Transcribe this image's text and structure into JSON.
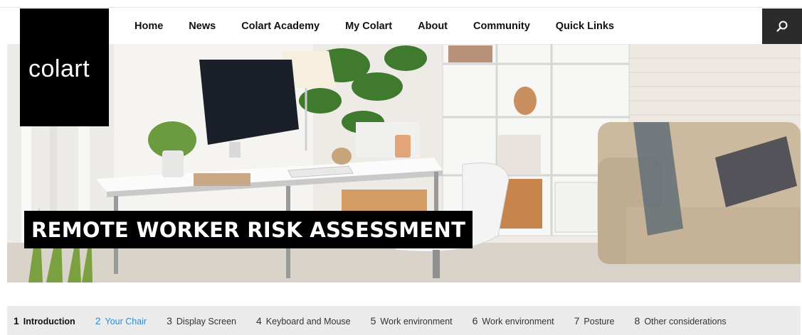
{
  "brand": {
    "logo_text": "colart"
  },
  "nav": {
    "items": [
      {
        "label": "Home"
      },
      {
        "label": "News"
      },
      {
        "label": "Colart Academy"
      },
      {
        "label": "My Colart"
      },
      {
        "label": "About"
      },
      {
        "label": "Community"
      },
      {
        "label": "Quick Links"
      }
    ]
  },
  "search": {
    "icon": "search-icon"
  },
  "hero": {
    "title": "REMOTE WORKER RISK ASSESSMENT"
  },
  "steps": [
    {
      "num": "1",
      "label": "Introduction",
      "state": "active"
    },
    {
      "num": "2",
      "label": "Your Chair",
      "state": "current"
    },
    {
      "num": "3",
      "label": "Display Screen",
      "state": "plain"
    },
    {
      "num": "4",
      "label": "Keyboard and Mouse",
      "state": "plain"
    },
    {
      "num": "5",
      "label": "Work environment",
      "state": "plain"
    },
    {
      "num": "6",
      "label": "Work environment",
      "state": "plain"
    },
    {
      "num": "7",
      "label": "Posture",
      "state": "plain"
    },
    {
      "num": "8",
      "label": "Other considerations",
      "state": "plain"
    }
  ],
  "colors": {
    "accent": "#2f8bd6",
    "search_bg": "#2b2b2b",
    "logo_bg": "#000000",
    "steps_bg": "#ebebeb"
  }
}
